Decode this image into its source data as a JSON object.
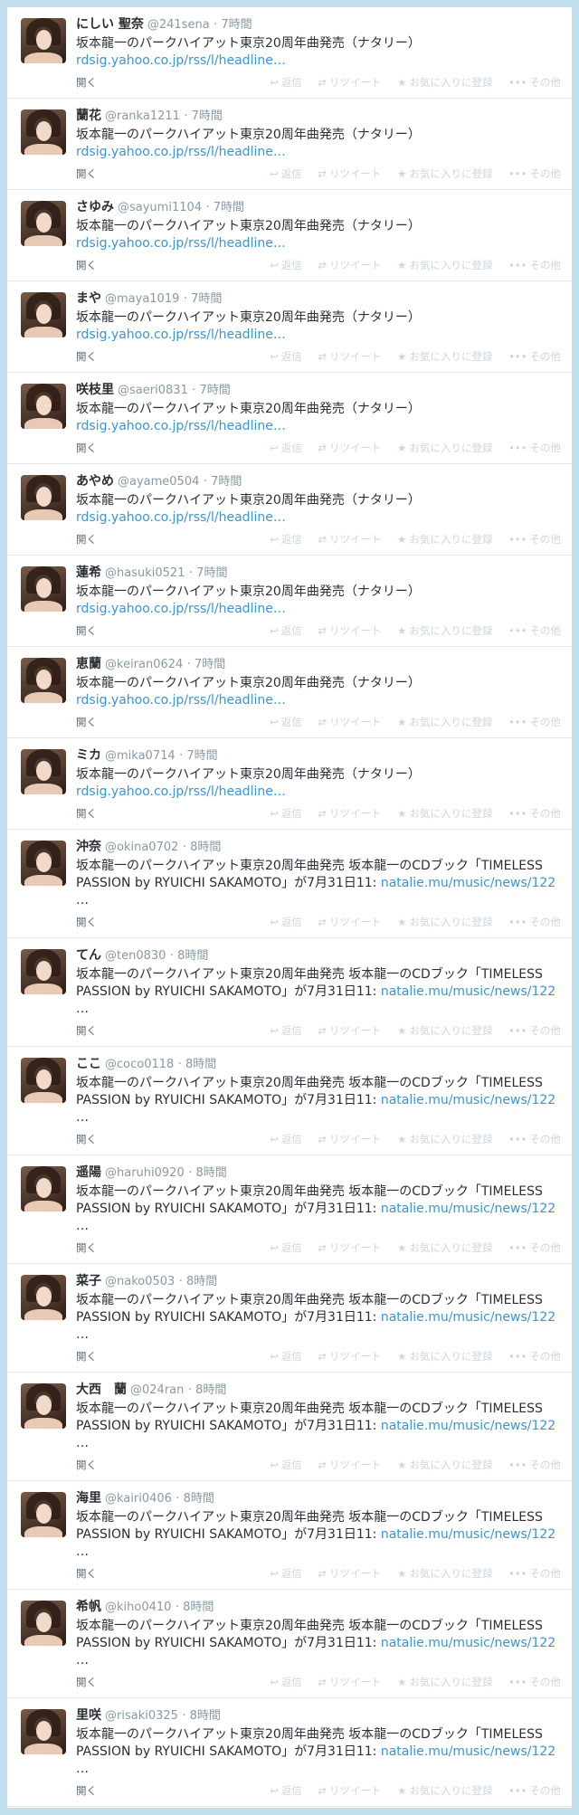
{
  "labels": {
    "open": "開く",
    "reply": "返信",
    "retweet": "リツイート",
    "favorite": "お気に入りに登録",
    "more": "その他"
  },
  "icons": {
    "reply": "reply-icon",
    "retweet": "retweet-icon",
    "favorite": "star-icon",
    "more": "more-dots-icon"
  },
  "colors": {
    "background": "#c0deed",
    "link": "#3b94d9",
    "muted": "#8899a6"
  },
  "tweets": [
    {
      "name": "にしい 聖奈",
      "handle": "@241sena",
      "time": "· 7時間",
      "text": "坂本龍一のパークハイアット東京20周年曲発売（ナタリー）",
      "link": "rdsig.yahoo.co.jp/rss/l/headline…",
      "ellipsis": ""
    },
    {
      "name": "蘭花",
      "handle": "@ranka1211",
      "time": "· 7時間",
      "text": "坂本龍一のパークハイアット東京20周年曲発売（ナタリー）",
      "link": "rdsig.yahoo.co.jp/rss/l/headline…",
      "ellipsis": ""
    },
    {
      "name": "さゆみ",
      "handle": "@sayumi1104",
      "time": "· 7時間",
      "text": "坂本龍一のパークハイアット東京20周年曲発売（ナタリー）",
      "link": "rdsig.yahoo.co.jp/rss/l/headline…",
      "ellipsis": ""
    },
    {
      "name": "まや",
      "handle": "@maya1019",
      "time": "· 7時間",
      "text": "坂本龍一のパークハイアット東京20周年曲発売（ナタリー）",
      "link": "rdsig.yahoo.co.jp/rss/l/headline…",
      "ellipsis": ""
    },
    {
      "name": "咲枝里",
      "handle": "@saeri0831",
      "time": "· 7時間",
      "text": "坂本龍一のパークハイアット東京20周年曲発売（ナタリー）",
      "link": "rdsig.yahoo.co.jp/rss/l/headline…",
      "ellipsis": ""
    },
    {
      "name": "あやめ",
      "handle": "@ayame0504",
      "time": "· 7時間",
      "text": "坂本龍一のパークハイアット東京20周年曲発売（ナタリー）",
      "link": "rdsig.yahoo.co.jp/rss/l/headline…",
      "ellipsis": ""
    },
    {
      "name": "蓮希",
      "handle": "@hasuki0521",
      "time": "· 7時間",
      "text": "坂本龍一のパークハイアット東京20周年曲発売（ナタリー）",
      "link": "rdsig.yahoo.co.jp/rss/l/headline…",
      "ellipsis": ""
    },
    {
      "name": "恵蘭",
      "handle": "@keiran0624",
      "time": "· 7時間",
      "text": "坂本龍一のパークハイアット東京20周年曲発売（ナタリー）",
      "link": "rdsig.yahoo.co.jp/rss/l/headline…",
      "ellipsis": ""
    },
    {
      "name": "ミカ",
      "handle": "@mika0714",
      "time": "· 7時間",
      "text": "坂本龍一のパークハイアット東京20周年曲発売（ナタリー）",
      "link": "rdsig.yahoo.co.jp/rss/l/headline…",
      "ellipsis": ""
    },
    {
      "name": "沖奈",
      "handle": "@okina0702",
      "time": "· 8時間",
      "text": "坂本龍一のパークハイアット東京20周年曲発売 坂本龍一のCDブック「TIMELESS PASSION by RYUICHI SAKAMOTO」が7月31日11:",
      "link": "natalie.mu/music/news/122",
      "ellipsis": "…"
    },
    {
      "name": "てん",
      "handle": "@ten0830",
      "time": "· 8時間",
      "text": "坂本龍一のパークハイアット東京20周年曲発売 坂本龍一のCDブック「TIMELESS PASSION by RYUICHI SAKAMOTO」が7月31日11:",
      "link": "natalie.mu/music/news/122",
      "ellipsis": "…"
    },
    {
      "name": "ここ",
      "handle": "@coco0118",
      "time": "· 8時間",
      "text": "坂本龍一のパークハイアット東京20周年曲発売 坂本龍一のCDブック「TIMELESS PASSION by RYUICHI SAKAMOTO」が7月31日11:",
      "link": "natalie.mu/music/news/122",
      "ellipsis": "…"
    },
    {
      "name": "遥陽",
      "handle": "@haruhi0920",
      "time": "· 8時間",
      "text": "坂本龍一のパークハイアット東京20周年曲発売 坂本龍一のCDブック「TIMELESS PASSION by RYUICHI SAKAMOTO」が7月31日11:",
      "link": "natalie.mu/music/news/122",
      "ellipsis": "…"
    },
    {
      "name": "菜子",
      "handle": "@nako0503",
      "time": "· 8時間",
      "text": "坂本龍一のパークハイアット東京20周年曲発売 坂本龍一のCDブック「TIMELESS PASSION by RYUICHI SAKAMOTO」が7月31日11:",
      "link": "natalie.mu/music/news/122",
      "ellipsis": "…"
    },
    {
      "name": "大西　蘭",
      "handle": "@024ran",
      "time": "· 8時間",
      "text": "坂本龍一のパークハイアット東京20周年曲発売 坂本龍一のCDブック「TIMELESS PASSION by RYUICHI SAKAMOTO」が7月31日11:",
      "link": "natalie.mu/music/news/122",
      "ellipsis": "…"
    },
    {
      "name": "海里",
      "handle": "@kairi0406",
      "time": "· 8時間",
      "text": "坂本龍一のパークハイアット東京20周年曲発売 坂本龍一のCDブック「TIMELESS PASSION by RYUICHI SAKAMOTO」が7月31日11:",
      "link": "natalie.mu/music/news/122",
      "ellipsis": "…"
    },
    {
      "name": "希帆",
      "handle": "@kiho0410",
      "time": "· 8時間",
      "text": "坂本龍一のパークハイアット東京20周年曲発売 坂本龍一のCDブック「TIMELESS PASSION by RYUICHI SAKAMOTO」が7月31日11:",
      "link": "natalie.mu/music/news/122",
      "ellipsis": "…"
    },
    {
      "name": "里咲",
      "handle": "@risaki0325",
      "time": "· 8時間",
      "text": "坂本龍一のパークハイアット東京20周年曲発売 坂本龍一のCDブック「TIMELESS PASSION by RYUICHI SAKAMOTO」が7月31日11:",
      "link": "natalie.mu/music/news/122",
      "ellipsis": "…"
    }
  ]
}
